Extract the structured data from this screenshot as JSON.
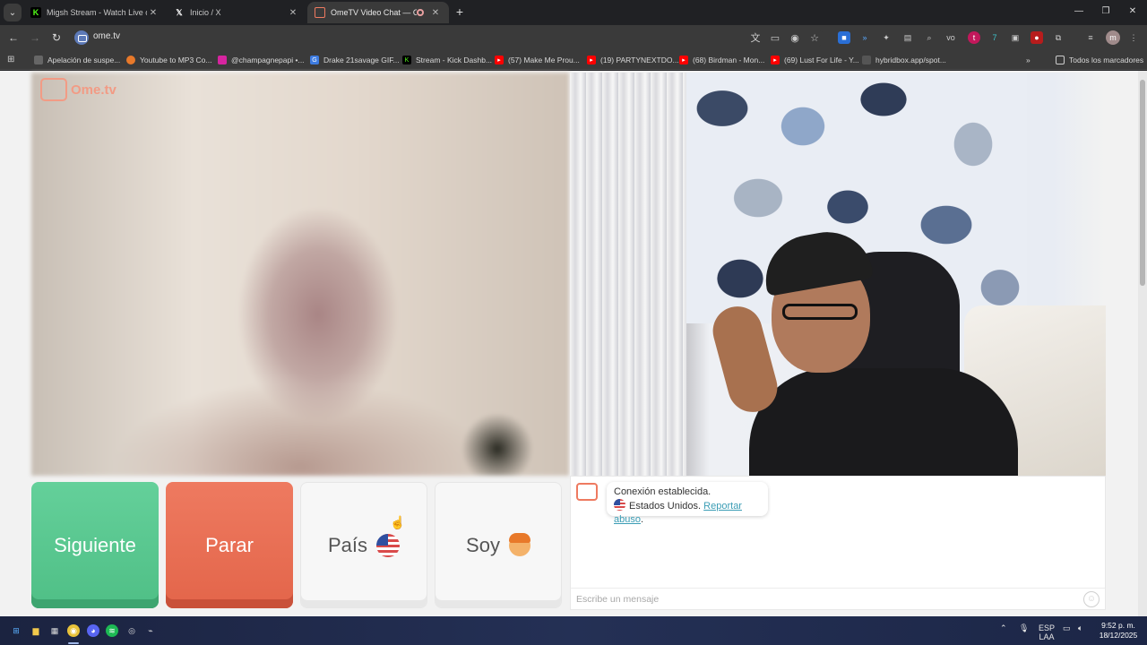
{
  "browser": {
    "tabs": [
      {
        "title": "Migsh Stream - Watch Live on ",
        "favicon": "kick-icon",
        "color": "#53fc18"
      },
      {
        "title": "Inicio / X",
        "favicon": "x-icon",
        "color": "#ffffff"
      },
      {
        "title": "OmeTV Video Chat — Ome",
        "favicon": "ometv-icon",
        "color": "#ee7a60",
        "active": true
      }
    ],
    "url": "ome.tv",
    "bookmarks": [
      {
        "label": "Apelación de suspe...",
        "icon": "folder-icon",
        "color": "#666666"
      },
      {
        "label": "Youtube to MP3 Co...",
        "icon": "converter-icon",
        "color": "#e8792a"
      },
      {
        "label": "@champagnepapi •...",
        "icon": "instagram-icon",
        "color": "#d6249f"
      },
      {
        "label": "Drake 21savage GIF...",
        "icon": "gif-icon",
        "color": "#3d7be0"
      },
      {
        "label": "Stream - Kick Dashb...",
        "icon": "kick-icon",
        "color": "#53fc18"
      },
      {
        "label": "(57) Make Me Prou...",
        "icon": "youtube-icon",
        "color": "#ff0000"
      },
      {
        "label": "(19) PARTYNEXTDO...",
        "icon": "youtube-icon",
        "color": "#ff0000"
      },
      {
        "label": "(68) Birdman - Mon...",
        "icon": "youtube-icon",
        "color": "#ff0000"
      },
      {
        "label": "(69) Lust For Life - Y...",
        "icon": "youtube-icon",
        "color": "#ff0000"
      },
      {
        "label": "hybridbox.app/spot...",
        "icon": "hybridbox-icon",
        "color": "#555555"
      }
    ],
    "all_bookmarks": "Todos los marcadores",
    "profile_initial": "m"
  },
  "ometv": {
    "logo_text": "Ome.tv",
    "logo_badge": "Ome TV",
    "buttons": {
      "next": "Siguiente",
      "stop": "Parar",
      "country": "País",
      "gender": "Soy"
    },
    "colors": {
      "next": "#56c58c",
      "stop": "#e86b50",
      "link": "#3b9db5"
    },
    "chat": {
      "connection_message": "Conexión establecida.",
      "country_name": "Estados Unidos.",
      "report_link": "Reportar abuso",
      "placeholder": "Escribe un mensaje"
    }
  },
  "taskbar": {
    "language_line1": "ESP",
    "language_line2": "LAA",
    "time": "9:52 p. m.",
    "date": "18/12/2025"
  }
}
